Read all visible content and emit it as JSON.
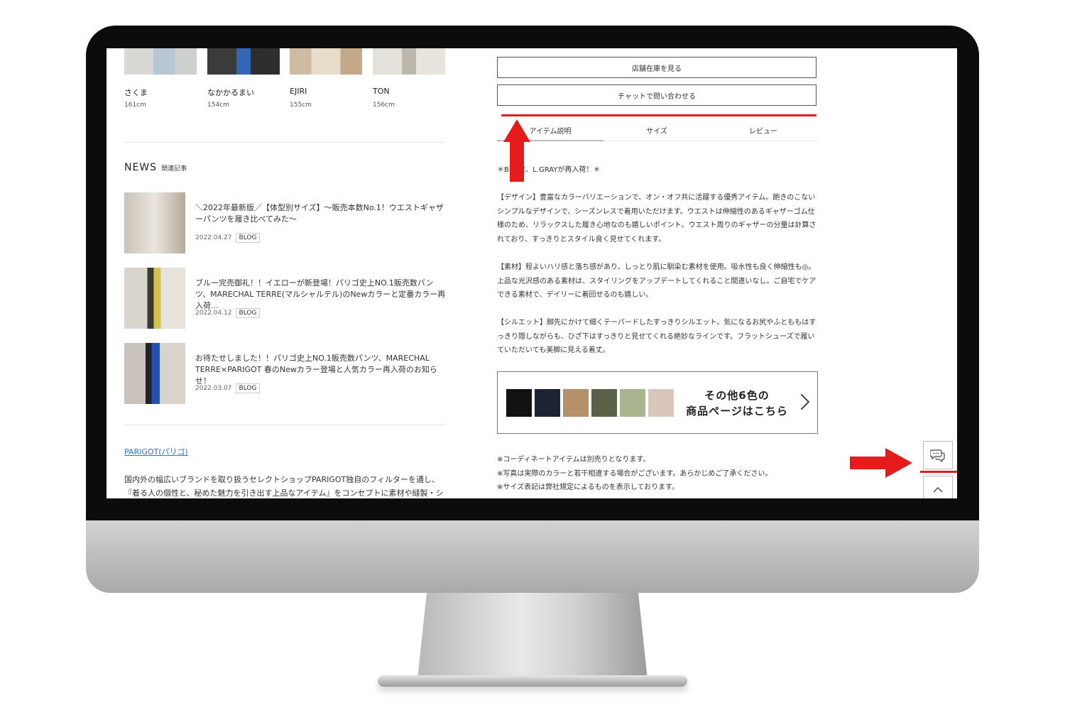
{
  "models": [
    {
      "name": "さくま",
      "height": "161cm"
    },
    {
      "name": "なかかるまい",
      "height": "154cm"
    },
    {
      "name": "EJIRI",
      "height": "155cm"
    },
    {
      "name": "TON",
      "height": "156cm"
    }
  ],
  "news": {
    "heading": "NEWS",
    "subheading": "関連記事",
    "articles": [
      {
        "title": "＼2022年最新版／【体型別サイズ】〜販売本数No.1！ウエストギャザーパンツを履き比べてみた〜",
        "date": "2022.04.27",
        "tag": "BLOG"
      },
      {
        "title": "ブルー完売御礼！！イエローが新登場！パリゴ史上NO.1販売数パンツ、MARECHAL TERRE(マルシャルテル)のNewカラーと定番カラー再入荷...",
        "date": "2022.04.12",
        "tag": "BLOG"
      },
      {
        "title": "お待たせしました！！パリゴ史上NO.1販売数パンツ、MARECHAL TERRE×PARIGOT 春のNewカラー登場と人気カラー再入荷のお知らせ！",
        "date": "2022.03.07",
        "tag": "BLOG"
      }
    ]
  },
  "brand": {
    "link": "PARIGOT(パリゴ)",
    "description": "国内外の幅広いブランドを取り扱うセレクトショップPARIGOT独自のフィルターを通し、『着る人の個性と、秘めた魅力を引き出す上品なアイテム』をコンセプトに素材や縫製・シ"
  },
  "buttons": {
    "store_stock": "店舗在庫を見る",
    "chat_inquiry": "チャットで問い合わせる"
  },
  "tabs": [
    "アイテム説明",
    "サイズ",
    "レビュー"
  ],
  "description": {
    "restock": "＊BEIGE、L.GRAYが再入荷！＊",
    "design": "【デザイン】豊富なカラーバリエーションで、オン・オフ共に活躍する優秀アイテム。飽きのこないシンプルなデザインで、シーズンレスで着用いただけます。ウエストは伸縮性のあるギャザーゴム仕様のため、リラックスした履き心地なのも嬉しいポイント。ウエスト周りのギャザーの分量は計算されており、すっきりとスタイル良く見せてくれます。",
    "material": "【素材】程よいハリ感と落ち感があり、しっとり肌に馴染む素材を使用。吸水性も良く伸縮性も◎。上品な光沢感のある素材は、スタイリングをアップデートしてくれること間違いなし。ご自宅でケアできる素材で、デイリーに着回せるのも嬉しい。",
    "silhouette": "【シルエット】脚先にかけて細くテーパードしたすっきりシルエット。気になるお尻やふとももはすっきり隠しながらも、ひざ下はすっきりと見せてくれる絶妙なラインです。フラットシューズで履いていただいても美脚に見える着丈。"
  },
  "other_colors": {
    "line1": "その他6色の",
    "line2": "商品ページはこちら",
    "swatches": [
      "#121212",
      "#1c2333",
      "#b5906b",
      "#5b6049",
      "#a8b58e",
      "#d9c6ba"
    ]
  },
  "notes": [
    "※コーディネートアイテムは別売りとなります。",
    "※写真は実際のカラーと若干相違する場合がございます。あらかじめご了承ください。",
    "※サイズ表記は弊社規定によるものを表示しております。"
  ],
  "accent_color": "#e61c1c",
  "link_color": "#2a78c2",
  "icons": {
    "chat": "chat-bubbles-icon",
    "page_top": "chevron-up-icon"
  }
}
